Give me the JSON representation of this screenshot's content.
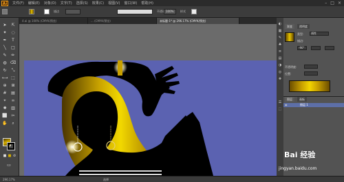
{
  "app": {
    "logo": "Ai"
  },
  "menu": [
    "文件(F)",
    "编辑(E)",
    "对象(O)",
    "文字(T)",
    "选择(S)",
    "效果(C)",
    "视图(V)",
    "窗口(W)",
    "帮助(H)"
  ],
  "control": {
    "style_label": "描边",
    "opacity": "不透明度",
    "pct": "100%",
    "style": "样式"
  },
  "doc_tabs": [
    {
      "label": "4.ai @ 100% (CMYK/预览)",
      "active": false
    },
    {
      "label": "... (CMYK/预览)",
      "active": false
    },
    {
      "label": "未标题-1* @ 296.17% (CMYK/预览)",
      "active": true
    }
  ],
  "gradient_panel": {
    "tab1": "渐变",
    "tab2": "透明度",
    "type_label": "类型:",
    "type_value": "线性",
    "angle_value": "-90°",
    "stroke_label": "描边:",
    "opacity_label": "不透明度:",
    "location_label": "位置:"
  },
  "layers_panel": {
    "tab1": "图层",
    "tab2": "画板",
    "layer_name": "图层 1"
  },
  "status": {
    "zoom": "296.17%",
    "tool": "选择"
  },
  "watermark": {
    "text": "Bai 经验",
    "url": "jingyan.baidu.com"
  },
  "colors": {
    "artboard": "#5b62b1",
    "gold": "#d8b100"
  }
}
